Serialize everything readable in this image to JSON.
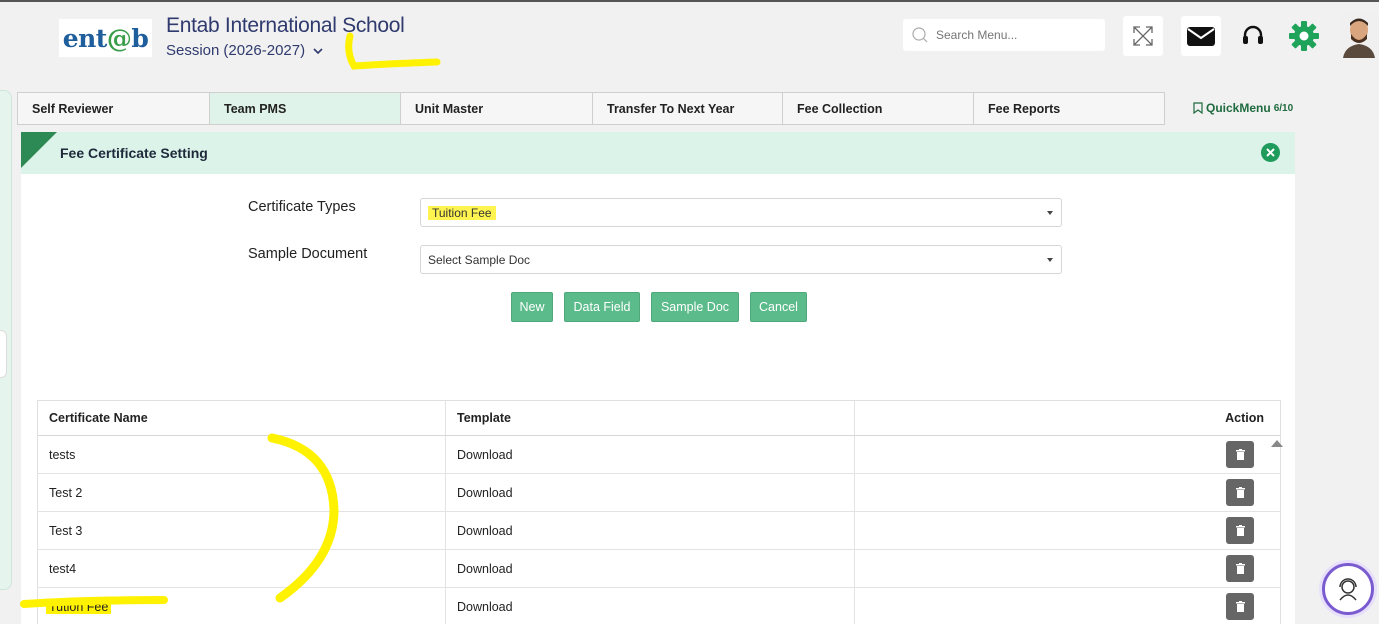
{
  "header": {
    "logo_text": "entab",
    "school_name": "Entab International School",
    "session_label": "Session",
    "session_value": "(2026-2027)",
    "search_placeholder": "Search Menu..."
  },
  "menu_tabs": [
    {
      "label": "Self Reviewer",
      "active": false
    },
    {
      "label": "Team PMS",
      "active": true
    },
    {
      "label": "Unit Master",
      "active": false
    },
    {
      "label": "Transfer To Next Year",
      "active": false
    },
    {
      "label": "Fee Collection",
      "active": false
    },
    {
      "label": "Fee Reports",
      "active": false
    }
  ],
  "quickmenu": {
    "label": "QuickMenu",
    "count": "6/10"
  },
  "panel": {
    "title": "Fee Certificate Setting",
    "certificate_types_label": "Certificate Types",
    "certificate_types_value": "Tuition Fee",
    "sample_document_label": "Sample Document",
    "sample_document_value": "Select Sample Doc",
    "buttons": {
      "new": "New",
      "data_field": "Data Field",
      "sample_doc": "Sample Doc",
      "cancel": "Cancel"
    }
  },
  "table": {
    "headers": [
      "Certificate Name",
      "Template",
      "Action"
    ],
    "rows": [
      {
        "name": "tests",
        "template": "Download"
      },
      {
        "name": "Test 2",
        "template": "Download"
      },
      {
        "name": "Test 3",
        "template": "Download"
      },
      {
        "name": "test4",
        "template": "Download"
      },
      {
        "name": "Tution Fee",
        "template": "Download"
      }
    ]
  },
  "colors": {
    "accent": "#5cbb8b",
    "header_bg": "#dcf3ea",
    "highlight": "#fff200"
  }
}
